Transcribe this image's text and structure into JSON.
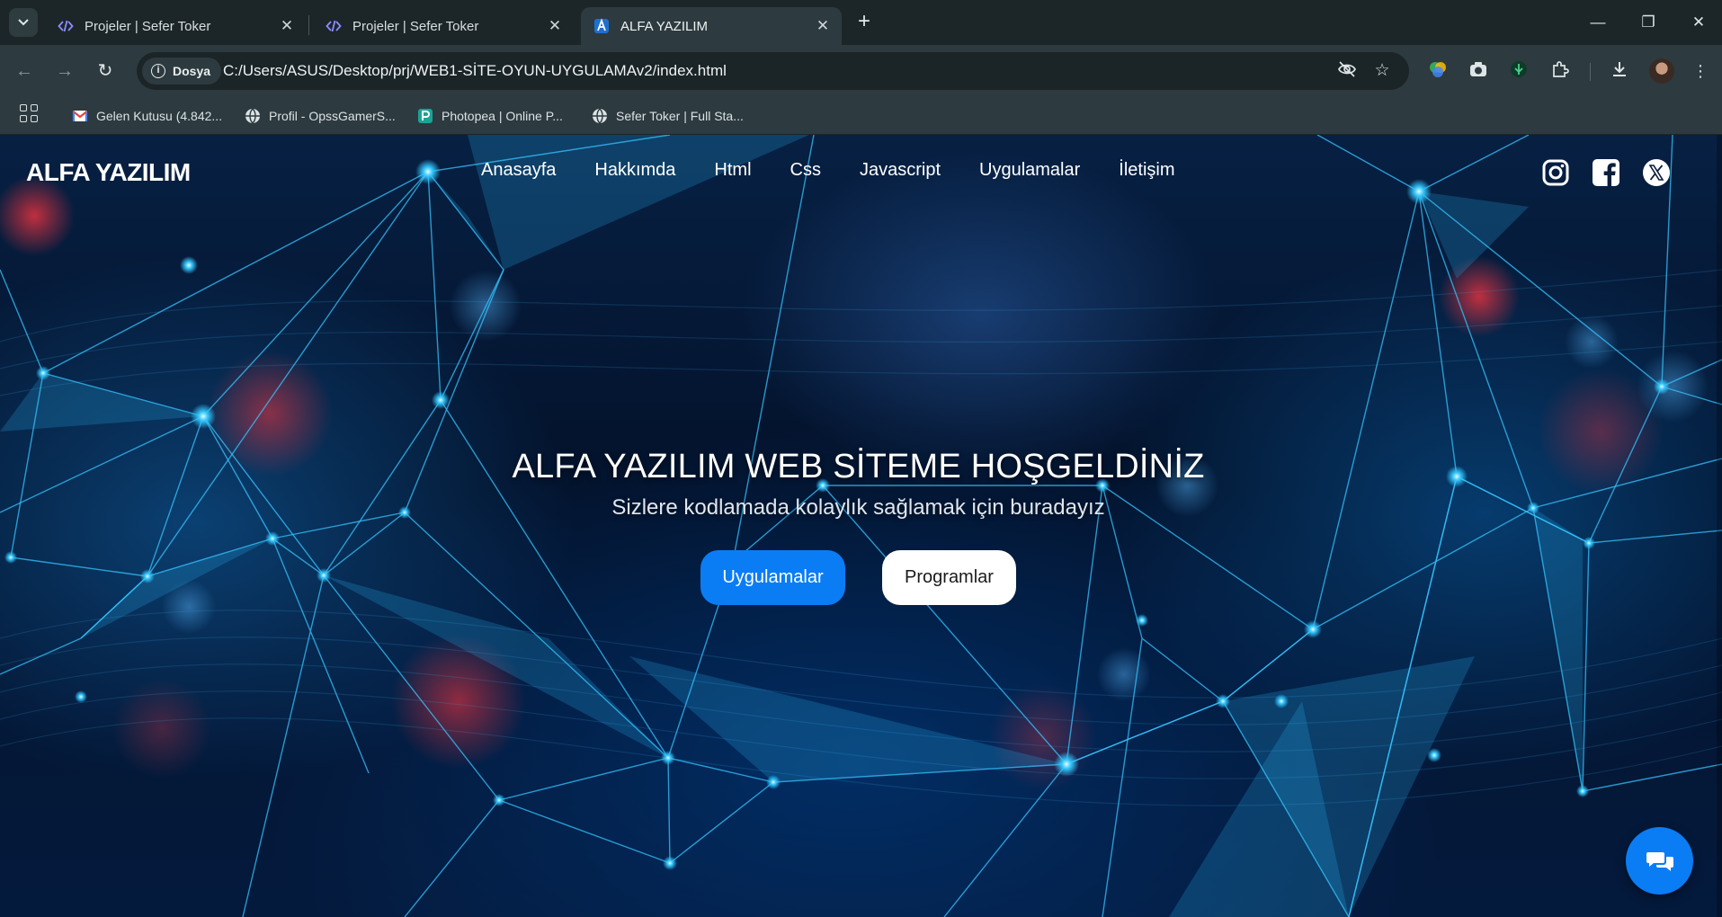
{
  "browser": {
    "tabs": [
      {
        "title": "Projeler | Sefer Toker",
        "icon": "code-icon"
      },
      {
        "title": "Projeler | Sefer Toker",
        "icon": "code-icon"
      },
      {
        "title": "ALFA YAZILIM",
        "icon": "site-favicon",
        "active": true
      }
    ],
    "chip_label": "Dosya",
    "url": "C:/Users/ASUS/Desktop/prj/WEB1-SİTE-OYUN-UYGULAMAv2/index.html",
    "bookmarks": [
      {
        "label": "Gelen Kutusu (4.842...",
        "icon": "gmail-icon"
      },
      {
        "label": "Profil - OpssGamerS...",
        "icon": "globe-icon"
      },
      {
        "label": "Photopea | Online P...",
        "icon": "photopea-icon"
      },
      {
        "label": "Sefer Toker | Full Sta...",
        "icon": "globe-icon"
      }
    ]
  },
  "site": {
    "logo": "ALFA YAZILIM",
    "nav": [
      "Anasayfa",
      "Hakkımda",
      "Html",
      "Css",
      "Javascript",
      "Uygulamalar",
      "İletişim"
    ],
    "social": [
      "instagram-icon",
      "facebook-icon",
      "x-icon"
    ],
    "hero": {
      "title": "ALFA YAZILIM WEB SİTEME HOŞGELDİNİZ",
      "subtitle": "Sizlere kodlamada kolaylık sağlamak için buradayız",
      "primary_button": "Uygulamalar",
      "secondary_button": "Programlar"
    },
    "colors": {
      "accent": "#0a7df5",
      "button_secondary_bg": "#ffffff"
    }
  }
}
